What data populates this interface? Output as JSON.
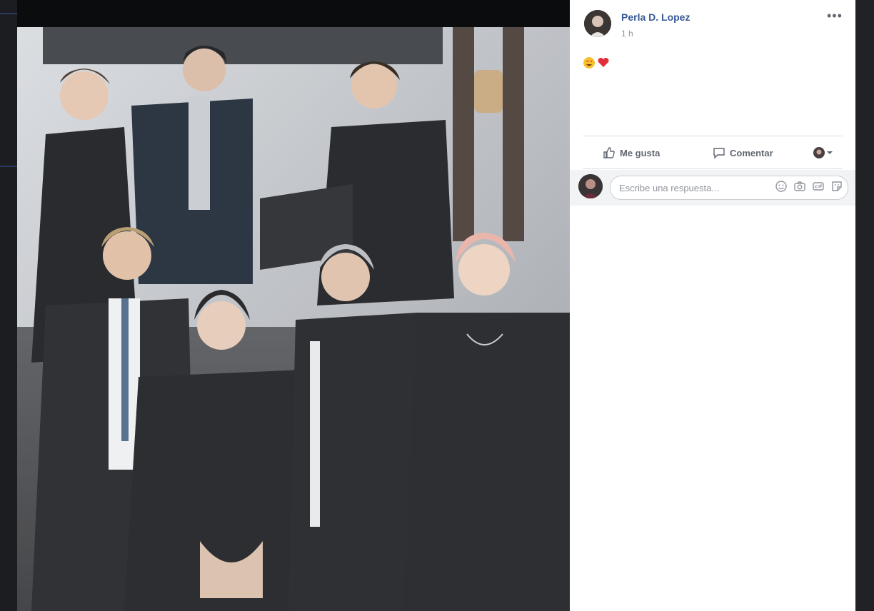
{
  "post": {
    "author_name": "Perla D. Lopez",
    "timestamp": "1 h",
    "more_icon": "more-options-icon",
    "caption_emojis": [
      "smiling-heart-eyes-emoji",
      "red-heart-emoji"
    ]
  },
  "actions": {
    "like_label": "Me gusta",
    "comment_label": "Comentar",
    "like_icon": "thumbs-up-icon",
    "comment_icon": "speech-bubble-icon"
  },
  "reply": {
    "placeholder": "Escribe una respuesta...",
    "icons": [
      "emoji-icon",
      "camera-icon",
      "gif-icon",
      "sticker-icon"
    ]
  },
  "colors": {
    "author_link": "#385898",
    "secondary_text": "#90949c",
    "action_text": "#606770"
  }
}
